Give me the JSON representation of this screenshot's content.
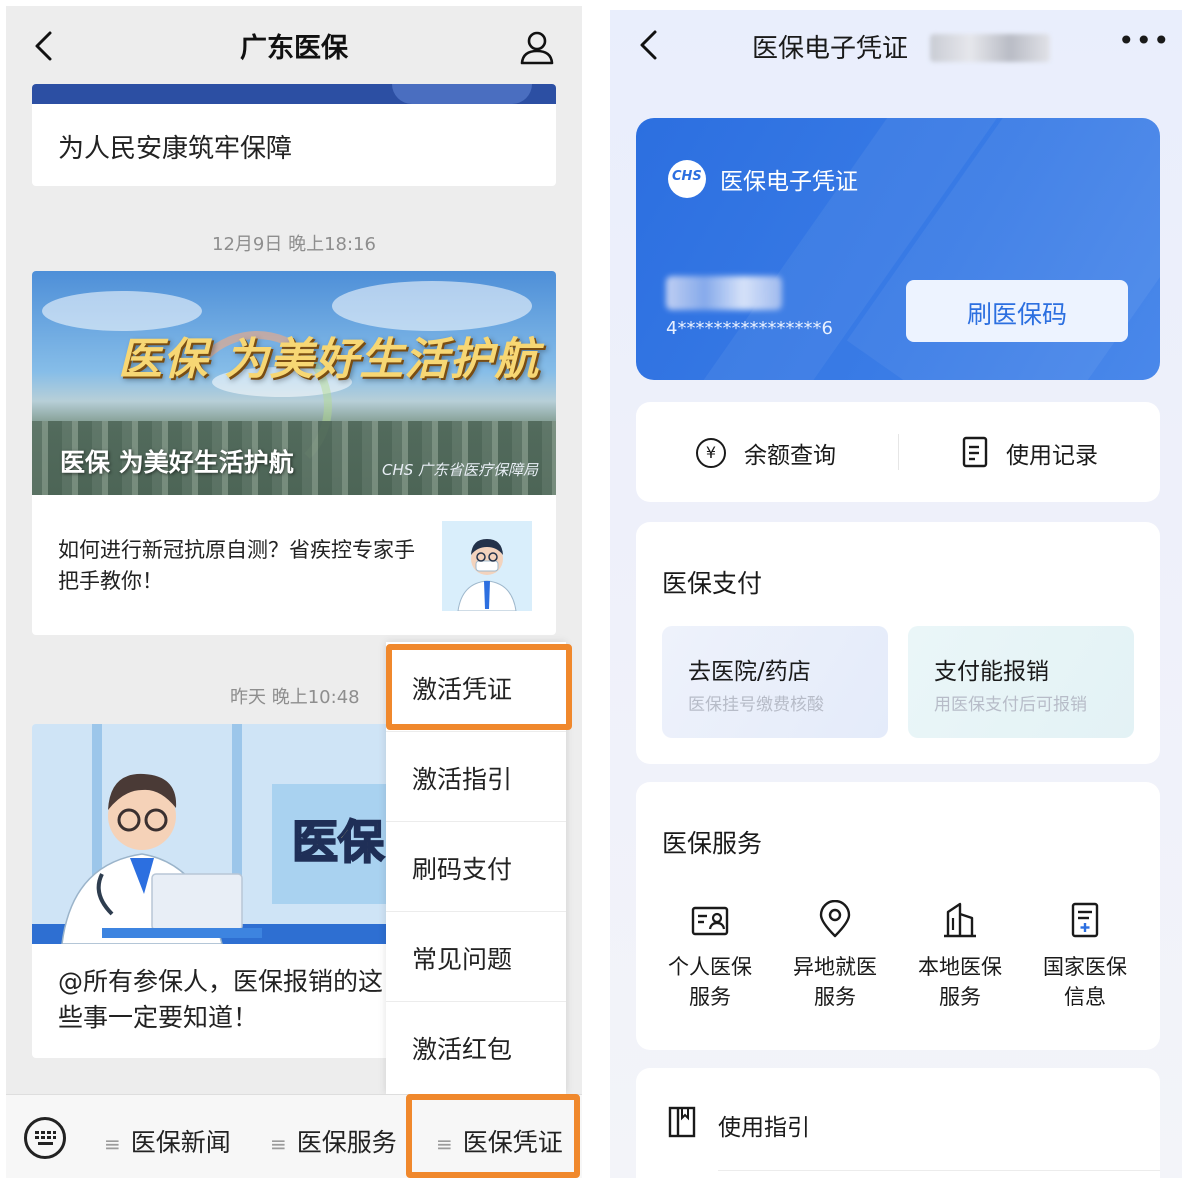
{
  "left_phone": {
    "header": {
      "title": "广东医保"
    },
    "feed": {
      "card1_text": "为人民安康筑牢保障",
      "time1": "12月9日 晚上18:16",
      "card2": {
        "banner_slogan": "医保 为美好生活护航",
        "banner_caption": "医保 为美好生活护航",
        "banner_logo": "CHS 广东省医疗保障局",
        "article_title": "如何进行新冠抗原自测？省疾控专家手把手教你！"
      },
      "time2": "昨天 晚上10:48",
      "card3": {
        "banner_text": "医保",
        "article_title": "@所有参保人，医保报销的这些事一定要知道！"
      }
    },
    "popup_menu": {
      "items": [
        {
          "label": "激活凭证",
          "highlighted": true
        },
        {
          "label": "激活指引"
        },
        {
          "label": "刷码支付"
        },
        {
          "label": "常见问题"
        },
        {
          "label": "激活红包"
        }
      ]
    },
    "bottom_bar": {
      "tabs": [
        {
          "label": "医保新闻"
        },
        {
          "label": "医保服务"
        },
        {
          "label": "医保凭证",
          "highlighted": true
        }
      ]
    },
    "highlight_color": "#f0882c"
  },
  "right_phone": {
    "header": {
      "title": "医保电子凭证"
    },
    "card": {
      "title": "医保电子凭证",
      "logo_text": "CHS",
      "masked_number": "4****************6",
      "button_label": "刷医保码",
      "color": "#2c6fe0"
    },
    "quick_actions": [
      {
        "label": "余额查询",
        "icon": "yuan-icon"
      },
      {
        "label": "使用记录",
        "icon": "record-icon"
      }
    ],
    "payment": {
      "title": "医保支付",
      "tiles": [
        {
          "title": "去医院/药店",
          "subtitle": "医保挂号缴费核酸"
        },
        {
          "title": "支付能报销",
          "subtitle": "用医保支付后可报销"
        }
      ]
    },
    "services": {
      "title": "医保服务",
      "items": [
        {
          "line1": "个人医保",
          "line2": "服务",
          "icon": "id-card-icon"
        },
        {
          "line1": "异地就医",
          "line2": "服务",
          "icon": "location-pin-icon"
        },
        {
          "line1": "本地医保",
          "line2": "服务",
          "icon": "building-icon"
        },
        {
          "line1": "国家医保",
          "line2": "信息",
          "icon": "document-icon"
        }
      ]
    },
    "guide": {
      "label": "使用指引",
      "icon": "book-icon"
    }
  }
}
